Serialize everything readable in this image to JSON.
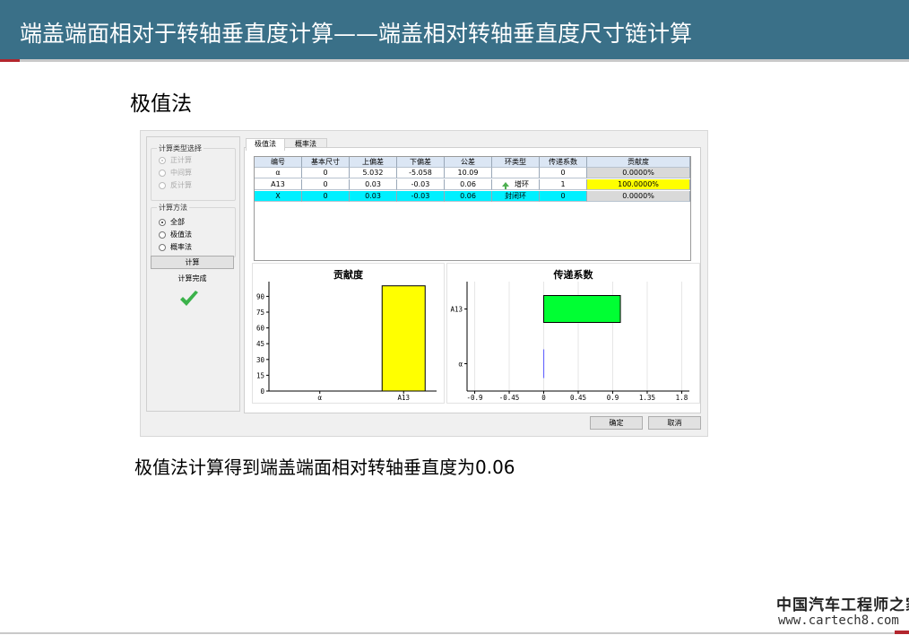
{
  "slide": {
    "title": "端盖端面相对于转轴垂直度计算——端盖相对转轴垂直度尺寸链计算",
    "section_heading": "极值法",
    "caption": "极值法计算得到端盖端面相对转轴垂直度为0.06",
    "footer_brand": "中国汽车工程师之家",
    "footer_url": "www.cartech8.com",
    "colors": {
      "header": "#3a7088",
      "accent": "#b3262d"
    }
  },
  "app": {
    "calc_type_group": {
      "title": "计算类型选择",
      "options": [
        {
          "label": "正计算",
          "selected": true
        },
        {
          "label": "中间算",
          "selected": false
        },
        {
          "label": "反计算",
          "selected": false
        }
      ]
    },
    "calc_method_group": {
      "title": "计算方法",
      "options": [
        {
          "label": "全部",
          "selected": true
        },
        {
          "label": "极值法",
          "selected": false
        },
        {
          "label": "概率法",
          "selected": false
        }
      ]
    },
    "calc_button": "计算",
    "status": "计算完成",
    "status_icon": "check-icon",
    "tabs": [
      {
        "label": "极值法",
        "active": true
      },
      {
        "label": "概率法",
        "active": false
      }
    ],
    "table": {
      "headers": [
        "编号",
        "基本尺寸",
        "上偏差",
        "下偏差",
        "公差",
        "环类型",
        "传递系数",
        "贡献度"
      ],
      "rows": [
        {
          "id": "α",
          "basic": "0",
          "upper": "5.032",
          "lower": "-5.058",
          "tol": "10.09",
          "ring": "",
          "coef": "0",
          "contrib": "0.0000%"
        },
        {
          "id": "A13",
          "basic": "0",
          "upper": "0.03",
          "lower": "-0.03",
          "tol": "0.06",
          "ring": "增环",
          "coef": "1",
          "contrib": "100.0000%"
        },
        {
          "id": "X",
          "basic": "0",
          "upper": "0.03",
          "lower": "-0.03",
          "tol": "0.06",
          "ring": "封闭环",
          "coef": "0",
          "contrib": "0.0000%"
        }
      ]
    },
    "ok_button": "确定",
    "cancel_button": "取消"
  },
  "chart_data": [
    {
      "type": "bar",
      "title": "贡献度",
      "categories": [
        "α",
        "A13"
      ],
      "values": [
        0,
        100
      ],
      "yticks": [
        0,
        15,
        30,
        45,
        60,
        75,
        90
      ],
      "ylim": [
        0,
        104
      ],
      "bar_color": "#ffff00",
      "grid": false
    },
    {
      "type": "bar",
      "orientation": "horizontal",
      "title": "传递系数",
      "categories": [
        "α",
        "A13"
      ],
      "values": [
        0,
        1
      ],
      "xticks": [
        "-0.9",
        "-0.45",
        "0",
        "0.45",
        "0.9",
        "1.35",
        "1.8"
      ],
      "xtick_values": [
        -0.9,
        -0.45,
        0,
        0.45,
        0.9,
        1.35,
        1.8
      ],
      "xlim": [
        -1.0,
        1.9
      ],
      "bar_color": "#00ff33",
      "grid": true
    }
  ]
}
